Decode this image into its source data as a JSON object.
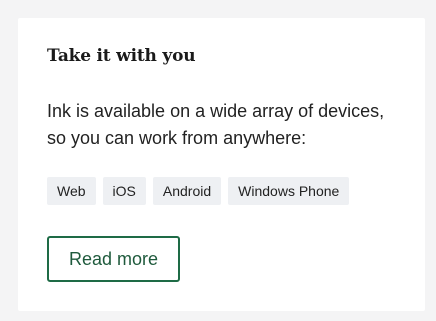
{
  "card": {
    "title": "Take it with you",
    "description": "Ink is available on a wide array of devices, so you can work from anywhere:",
    "tags": [
      "Web",
      "iOS",
      "Android",
      "Windows Phone"
    ],
    "button_label": "Read more"
  },
  "colors": {
    "page_background": "#f4f4f5",
    "card_background": "#ffffff",
    "tag_background": "#eef0f3",
    "accent": "#1e6b46"
  }
}
